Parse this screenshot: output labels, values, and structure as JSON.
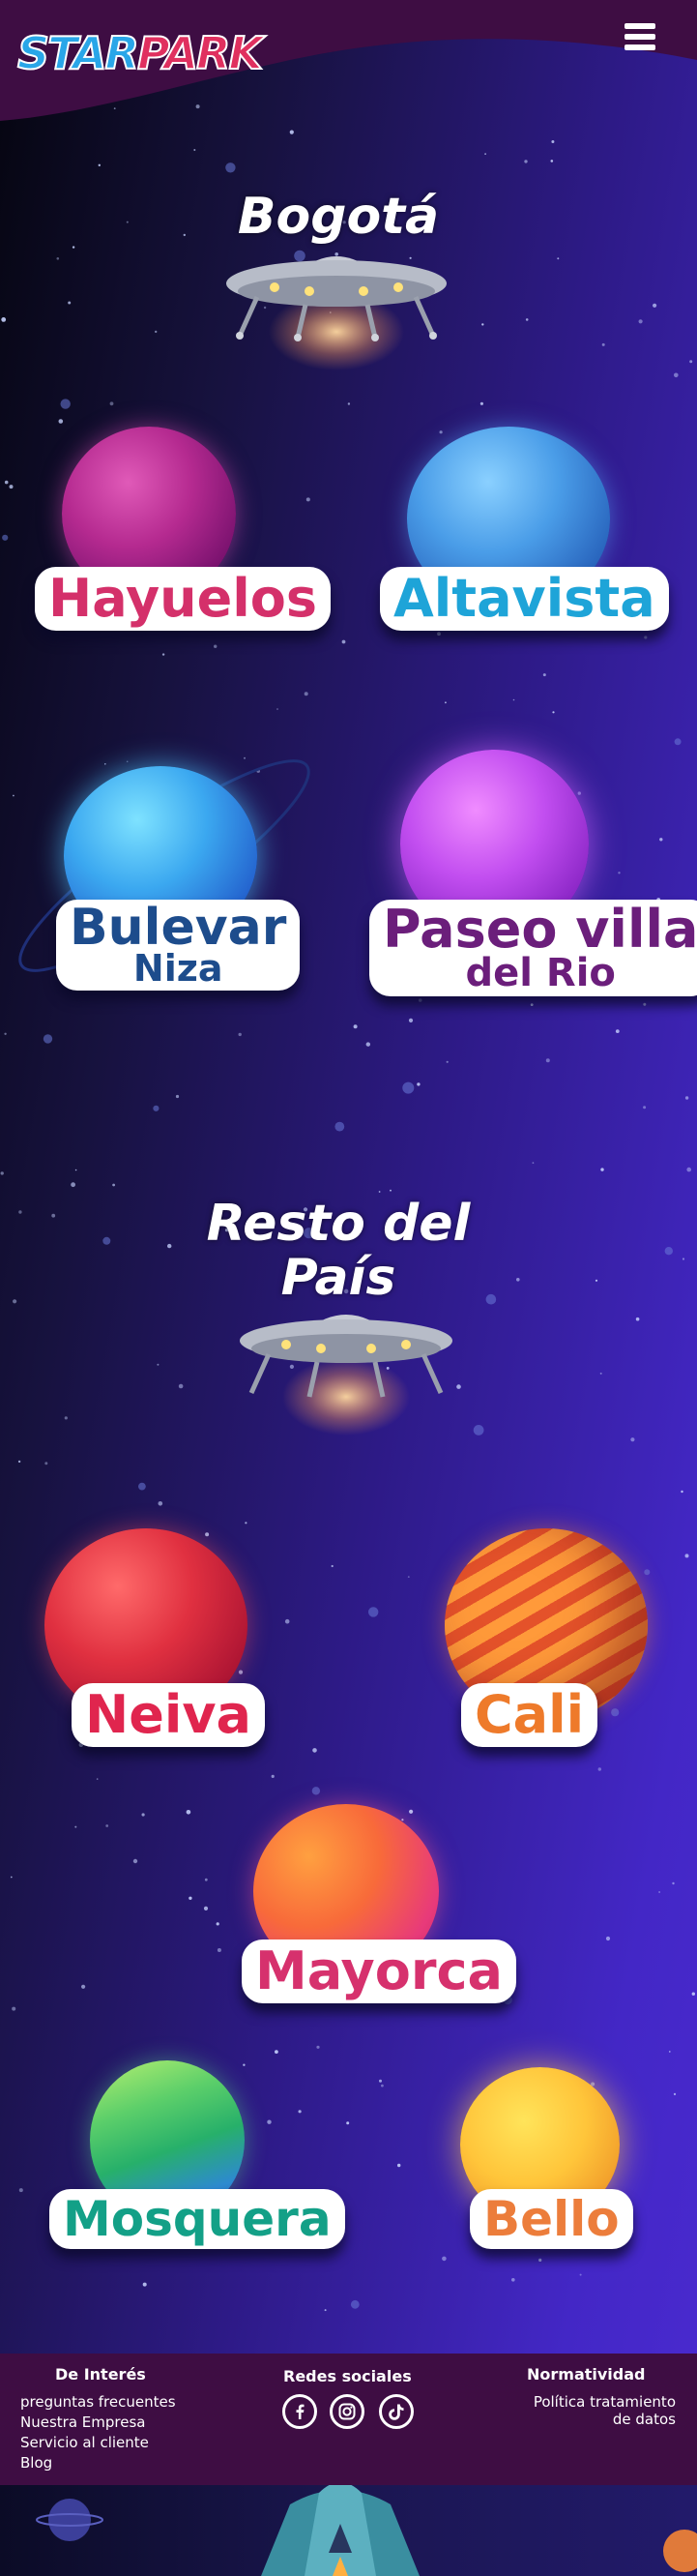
{
  "header": {
    "logo_star": "STAR",
    "logo_park": "PARK",
    "menu_icon": "hamburger-menu-icon"
  },
  "sections": {
    "bogota_title": "Bogotá",
    "resto_title_line1": "Resto del",
    "resto_title_line2": "País"
  },
  "parks": {
    "hayuelos": {
      "name": "Hayuelos",
      "color": "#d4306a"
    },
    "altavista": {
      "name": "Altavista",
      "color": "#1ea4d8"
    },
    "bulevar": {
      "name": "Bulevar",
      "sub": "Niza",
      "color": "#1d4c8c"
    },
    "paseo": {
      "name": "Paseo villa",
      "sub": "del Rio",
      "color": "#6b1e7b"
    },
    "neiva": {
      "name": "Neiva",
      "color": "#e0254e"
    },
    "cali": {
      "name": "Cali",
      "color": "#ee7a2a"
    },
    "mayorca": {
      "name": "Mayorca",
      "color": "#d6316d"
    },
    "mosquera": {
      "name": "Mosquera",
      "color": "#13a087"
    },
    "bello": {
      "name": "Bello",
      "color": "#ec7d3b"
    }
  },
  "footer": {
    "interest_title": "De Interés",
    "interest_links": [
      "preguntas frecuentes",
      "Nuestra Empresa",
      "Servicio al cliente",
      "Blog"
    ],
    "social_title": "Redes sociales",
    "social_icons": [
      "facebook-icon",
      "instagram-icon",
      "tiktok-icon"
    ],
    "norm_title": "Normatividad",
    "norm_link_line1": "Política tratamiento",
    "norm_link_line2": "de datos"
  }
}
